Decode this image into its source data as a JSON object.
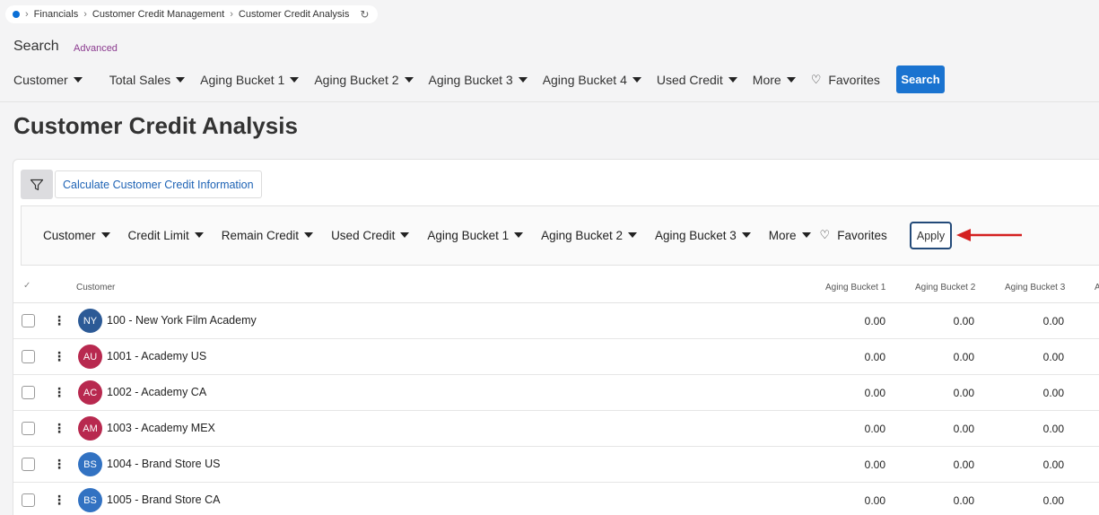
{
  "breadcrumb": {
    "items": [
      "Financials",
      "Customer Credit Management",
      "Customer Credit Analysis"
    ]
  },
  "search": {
    "title": "Search",
    "advanced_label": "Advanced",
    "filters": [
      "Customer",
      "Total Sales",
      "Aging Bucket 1",
      "Aging Bucket 2",
      "Aging Bucket 3",
      "Aging Bucket 4",
      "Used Credit",
      "More"
    ],
    "favorites_label": "Favorites",
    "search_button": "Search"
  },
  "page_title": "Customer Credit Analysis",
  "toolbar": {
    "calc_label": "Calculate Customer Credit Information"
  },
  "subfilter": {
    "filters": [
      "Customer",
      "Credit Limit",
      "Remain Credit",
      "Used Credit",
      "Aging Bucket 1",
      "Aging Bucket 2",
      "Aging Bucket 3",
      "More"
    ],
    "favorites_label": "Favorites",
    "apply_label": "Apply"
  },
  "table": {
    "columns": {
      "customer": "Customer",
      "aging1": "Aging Bucket 1",
      "aging2": "Aging Bucket 2",
      "aging3": "Aging Bucket 3",
      "aging4_partial": "A"
    },
    "rows": [
      {
        "initials": "NY",
        "color": "#2c5a96",
        "name": "100 - New York Film Academy",
        "a1": "0.00",
        "a2": "0.00",
        "a3": "0.00"
      },
      {
        "initials": "AU",
        "color": "#b8294f",
        "name": "1001 - Academy US",
        "a1": "0.00",
        "a2": "0.00",
        "a3": "0.00"
      },
      {
        "initials": "AC",
        "color": "#b8294f",
        "name": "1002 - Academy CA",
        "a1": "0.00",
        "a2": "0.00",
        "a3": "0.00"
      },
      {
        "initials": "AM",
        "color": "#b8294f",
        "name": "1003 - Academy MEX",
        "a1": "0.00",
        "a2": "0.00",
        "a3": "0.00"
      },
      {
        "initials": "BS",
        "color": "#3272c2",
        "name": "1004 - Brand Store US",
        "a1": "0.00",
        "a2": "0.00",
        "a3": "0.00"
      },
      {
        "initials": "BS",
        "color": "#3272c2",
        "name": "1005 - Brand Store CA",
        "a1": "0.00",
        "a2": "0.00",
        "a3": "0.00"
      }
    ]
  },
  "colors": {
    "accent": "#1a73d0",
    "arrow": "#d42020",
    "advanced": "#8b3a8f"
  }
}
